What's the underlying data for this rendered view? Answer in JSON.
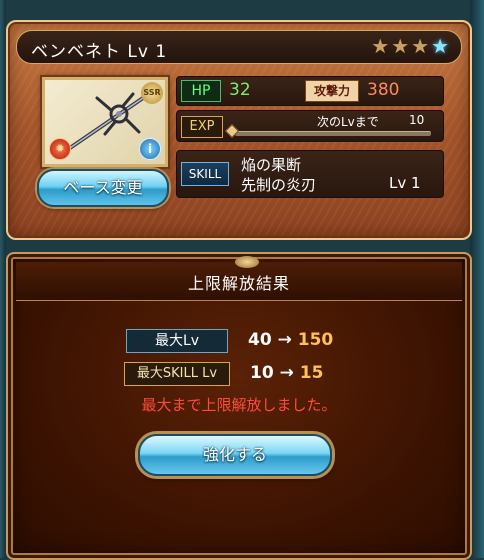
{
  "weapon": {
    "name": "ベンベネト",
    "level_text": "Lv 1",
    "rarity": "SSR",
    "stars_total": 4,
    "stars_filled": 3,
    "element_icon": "fire-element-icon",
    "colors": {
      "star_filled": "#c9a062",
      "star_blue": "#8be7ff",
      "hp": "#7cf06a",
      "attack": "#ff8a5c"
    }
  },
  "stats": {
    "hp_label": "HP",
    "hp_value": "32",
    "attack_label": "攻撃力",
    "attack_value": "380",
    "exp_label": "EXP",
    "next_level_text": "次のLvまで",
    "next_level_value": "10",
    "exp_progress": 0
  },
  "skill": {
    "label": "SKILL",
    "name": "焔の果断",
    "description": "先制の炎刃",
    "level_text": "Lv 1"
  },
  "buttons": {
    "base_change": "ベース変更",
    "enhance": "強化する"
  },
  "result": {
    "title": "上限解放結果",
    "rows": [
      {
        "label": "最大Lv",
        "old": "40",
        "arrow": "→",
        "new": "150"
      },
      {
        "label": "最大SKILL Lv",
        "old": "10",
        "arrow": "→",
        "new": "15"
      }
    ],
    "message": "最大まで上限解放しました。"
  }
}
